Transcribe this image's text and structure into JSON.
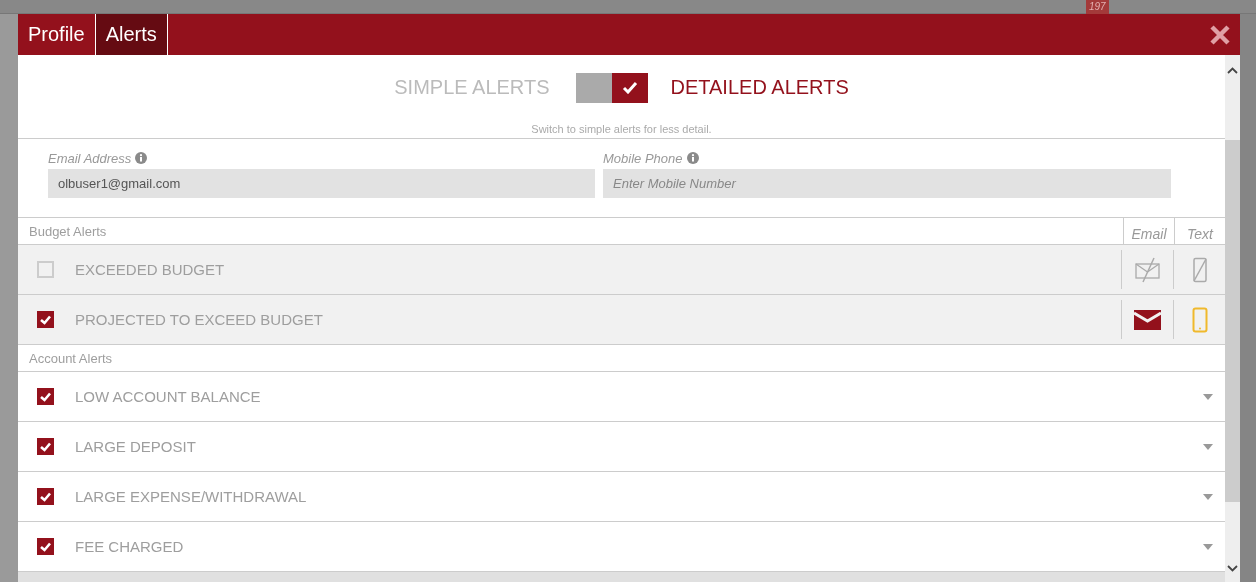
{
  "background": {
    "badge": "197"
  },
  "tabs": [
    {
      "label": "Profile",
      "selected": false
    },
    {
      "label": "Alerts",
      "selected": true
    }
  ],
  "mode_switch": {
    "left_label": "SIMPLE ALERTS",
    "right_label": "DETAILED ALERTS",
    "on": true,
    "hint": "Switch to simple alerts for less detail."
  },
  "fields": [
    {
      "label": "Email Address",
      "value": "olbuser1@gmail.com"
    },
    {
      "label": "Mobile Phone",
      "placeholder": "Enter Mobile Number"
    }
  ],
  "budget_alerts": {
    "title": "Budget Alerts",
    "columns": [
      "Email",
      "Text"
    ],
    "rows": [
      {
        "label": "EXCEEDED BUDGET",
        "checked": false,
        "email": false,
        "text": false
      },
      {
        "label": "PROJECTED TO EXCEED BUDGET",
        "checked": true,
        "email": true,
        "text": true
      }
    ]
  },
  "account_alerts": {
    "title": "Account Alerts",
    "rows": [
      {
        "label": "LOW ACCOUNT BALANCE",
        "checked": true,
        "expanded": false
      },
      {
        "label": "LARGE DEPOSIT",
        "checked": true,
        "expanded": false
      },
      {
        "label": "LARGE EXPENSE/WITHDRAWAL",
        "checked": true,
        "expanded": false
      },
      {
        "label": "FEE CHARGED",
        "checked": true,
        "expanded": false
      }
    ]
  }
}
